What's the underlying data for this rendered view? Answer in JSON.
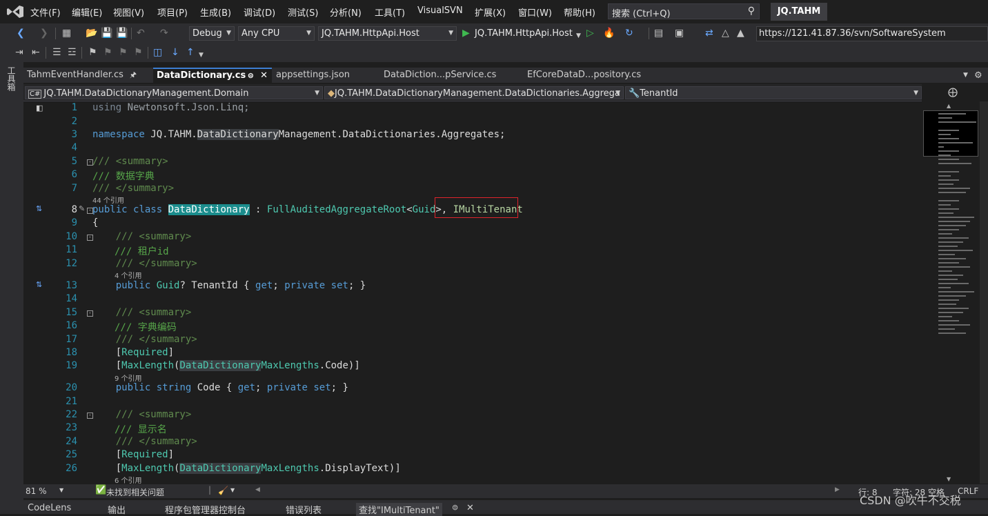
{
  "menu": {
    "items": [
      "文件(F)",
      "编辑(E)",
      "视图(V)",
      "项目(P)",
      "生成(B)",
      "调试(D)",
      "测试(S)",
      "分析(N)",
      "工具(T)",
      "VisualSVN",
      "扩展(X)",
      "窗口(W)",
      "帮助(H)"
    ],
    "search_label": "搜索 (Ctrl+Q)",
    "solution_name": "JQ.TAHM"
  },
  "toolbar": {
    "config": "Debug",
    "platform": "Any CPU",
    "startup_project": "JQ.TAHM.HttpApi.Host",
    "run_label": "JQ.TAHM.HttpApi.Host",
    "svn_url": "https://121.41.87.36/svn/SoftwareSystem"
  },
  "toolbox_label": "工具箱",
  "tabs": [
    {
      "label": "TahmEventHandler.cs",
      "active": false
    },
    {
      "label": "DataDictionary.cs",
      "active": true
    },
    {
      "label": "appsettings.json",
      "active": false
    },
    {
      "label": "DataDiction...pService.cs",
      "active": false
    },
    {
      "label": "EfCoreDataD...pository.cs",
      "active": false
    }
  ],
  "nav": {
    "project": "JQ.TAHM.DataDictionaryManagement.Domain",
    "type": "JQ.TAHM.DataDictionaryManagement.DataDictionaries.Aggrega",
    "member": "TenantId"
  },
  "code_lines": [
    {
      "n": "1",
      "text": "using Newtonsoft.Json.Linq;"
    },
    {
      "n": "2",
      "text": ""
    },
    {
      "n": "3",
      "text": "namespace JQ.TAHM.DataDictionaryManagement.DataDictionaries.Aggregates;"
    },
    {
      "n": "4",
      "text": ""
    },
    {
      "n": "5",
      "text": "/// <summary>"
    },
    {
      "n": "6",
      "text": "/// 数据字典"
    },
    {
      "n": "7",
      "text": "/// </summary>"
    },
    {
      "n": "8",
      "text": "public class DataDictionary : FullAuditedAggregateRoot<Guid>, IMultiTenant"
    },
    {
      "n": "9",
      "text": "{"
    },
    {
      "n": "10",
      "text": "/// <summary>"
    },
    {
      "n": "11",
      "text": "/// 租户id"
    },
    {
      "n": "12",
      "text": "/// </summary>"
    },
    {
      "n": "13",
      "text": "public Guid? TenantId { get; private set; }"
    },
    {
      "n": "14",
      "text": ""
    },
    {
      "n": "15",
      "text": "/// <summary>"
    },
    {
      "n": "16",
      "text": "/// 字典编码"
    },
    {
      "n": "17",
      "text": "/// </summary>"
    },
    {
      "n": "18",
      "text": "[Required]"
    },
    {
      "n": "19",
      "text": "[MaxLength(DataDictionaryMaxLengths.Code)]"
    },
    {
      "n": "20",
      "text": "public string Code { get; private set; }"
    },
    {
      "n": "21",
      "text": ""
    },
    {
      "n": "22",
      "text": "/// <summary>"
    },
    {
      "n": "23",
      "text": "/// 显示名"
    },
    {
      "n": "24",
      "text": "/// </summary>"
    },
    {
      "n": "25",
      "text": "[Required]"
    },
    {
      "n": "26",
      "text": "[MaxLength(DataDictionaryMaxLengths.DisplayText)]"
    }
  ],
  "codelens": {
    "class_refs": "44 个引用",
    "tenant_refs": "4 个引用",
    "code_refs": "9 个引用",
    "display_refs": "6 个引用"
  },
  "status": {
    "zoom": "81 %",
    "issues": "未找到相关问题",
    "line": "行: 8",
    "char": "字符: 28",
    "mode": "空格",
    "eol": "CRLF"
  },
  "bottom_tabs": [
    "CodeLens",
    "输出",
    "程序包管理器控制台",
    "错误列表",
    "查找\"IMultiTenant\""
  ],
  "watermark": "CSDN @吹牛不交税",
  "colors": {
    "accent": "#3d7ed3",
    "highlight_border": "#e0242c",
    "keyword": "#569cd6",
    "type": "#4ec9b0",
    "comment": "#57a64a"
  }
}
